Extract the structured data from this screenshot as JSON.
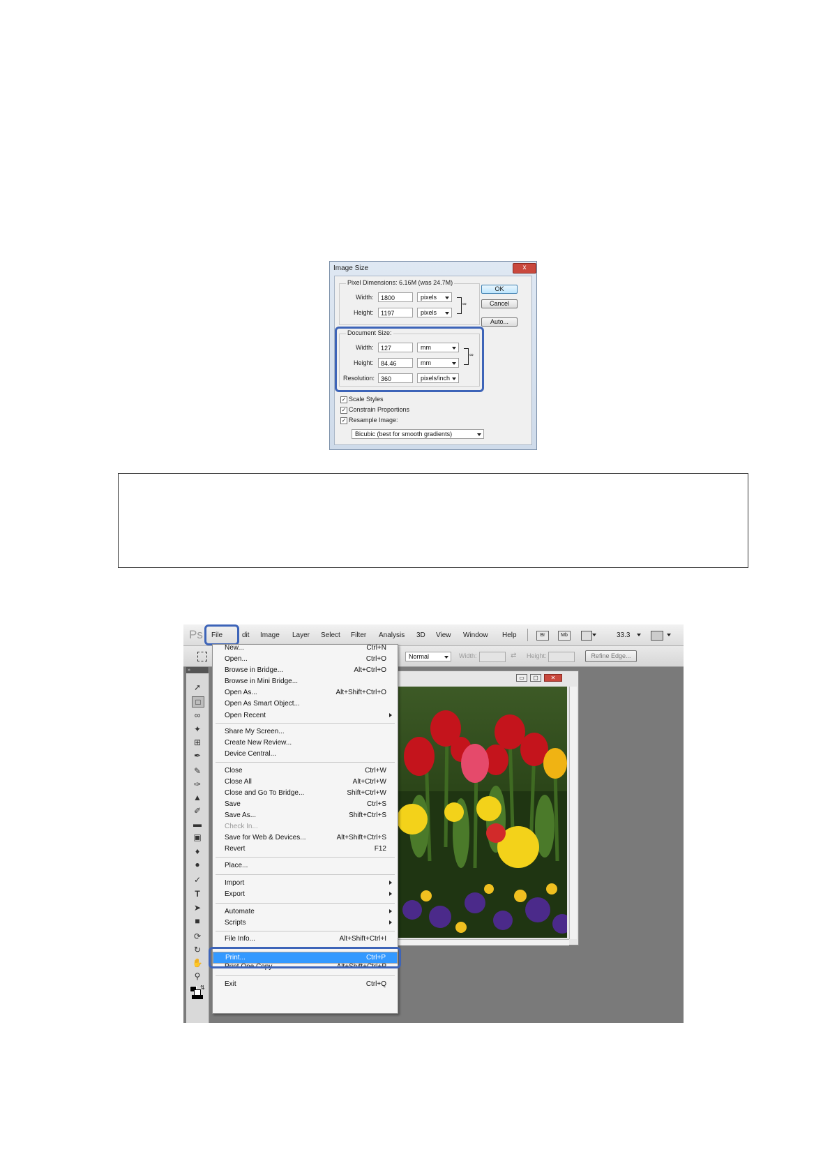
{
  "image_size_dialog": {
    "title": "Image Size",
    "close_glyph": "x",
    "pixel_dimensions": {
      "label": "Pixel Dimensions:",
      "value": "6.16M (was 24.7M)",
      "width_label": "Width:",
      "width_value": "1800",
      "width_unit": "pixels",
      "height_label": "Height:",
      "height_value": "1197",
      "height_unit": "pixels"
    },
    "document_size": {
      "label": "Document Size:",
      "width_label": "Width:",
      "width_value": "127",
      "width_unit": "mm",
      "height_label": "Height:",
      "height_value": "84.46",
      "height_unit": "mm",
      "resolution_label": "Resolution:",
      "resolution_value": "360",
      "resolution_unit": "pixels/inch"
    },
    "buttons": {
      "ok": "OK",
      "cancel": "Cancel",
      "auto": "Auto..."
    },
    "checkboxes": {
      "scale_styles": "Scale Styles",
      "constrain_proportions": "Constrain Proportions",
      "resample_image": "Resample Image:"
    },
    "resample_method": "Bicubic (best for smooth gradients)"
  },
  "photoshop": {
    "logo_text": "Ps",
    "menu": [
      "File",
      "dit",
      "Image",
      "Layer",
      "Select",
      "Filter",
      "Analysis",
      "3D",
      "View",
      "Window",
      "Help"
    ],
    "app_buttons": {
      "bridge": "Br",
      "minibridge": "Mb"
    },
    "zoom": "33.3",
    "options_bar": {
      "style_value": "Normal",
      "width_label": "Width:",
      "height_label": "Height:",
      "refine_edge": "Refine Edge..."
    },
    "window_controls": {
      "minimize": "▭",
      "restore": "▢",
      "close": "✕"
    },
    "file_menu": [
      {
        "label": "New...",
        "shortcut": "Ctrl+N"
      },
      {
        "label": "Open...",
        "shortcut": "Ctrl+O"
      },
      {
        "label": "Browse in Bridge...",
        "shortcut": "Alt+Ctrl+O"
      },
      {
        "label": "Browse in Mini Bridge...",
        "shortcut": ""
      },
      {
        "label": "Open As...",
        "shortcut": "Alt+Shift+Ctrl+O"
      },
      {
        "label": "Open As Smart Object...",
        "shortcut": ""
      },
      {
        "label": "Open Recent",
        "shortcut": ""
      },
      {
        "label": "Share My Screen...",
        "shortcut": ""
      },
      {
        "label": "Create New Review...",
        "shortcut": ""
      },
      {
        "label": "Device Central...",
        "shortcut": ""
      },
      {
        "label": "Close",
        "shortcut": "Ctrl+W"
      },
      {
        "label": "Close All",
        "shortcut": "Alt+Ctrl+W"
      },
      {
        "label": "Close and Go To Bridge...",
        "shortcut": "Shift+Ctrl+W"
      },
      {
        "label": "Save",
        "shortcut": "Ctrl+S"
      },
      {
        "label": "Save As...",
        "shortcut": "Shift+Ctrl+S"
      },
      {
        "label": "Check In...",
        "shortcut": ""
      },
      {
        "label": "Save for Web & Devices...",
        "shortcut": "Alt+Shift+Ctrl+S"
      },
      {
        "label": "Revert",
        "shortcut": "F12"
      },
      {
        "label": "Place...",
        "shortcut": ""
      },
      {
        "label": "Import",
        "shortcut": ""
      },
      {
        "label": "Export",
        "shortcut": ""
      },
      {
        "label": "Automate",
        "shortcut": ""
      },
      {
        "label": "Scripts",
        "shortcut": ""
      },
      {
        "label": "File Info...",
        "shortcut": "Alt+Shift+Ctrl+I"
      },
      {
        "label": "Print...",
        "shortcut": "Ctrl+P"
      },
      {
        "label": "Print One Copy",
        "shortcut": "Alt+Shift+Ctrl+P"
      },
      {
        "label": "Exit",
        "shortcut": "Ctrl+Q"
      }
    ]
  },
  "colors": {
    "highlight": "#3d64b8",
    "menu_selected": "#3399ff",
    "canvas_bg": "#7a7a7a"
  }
}
